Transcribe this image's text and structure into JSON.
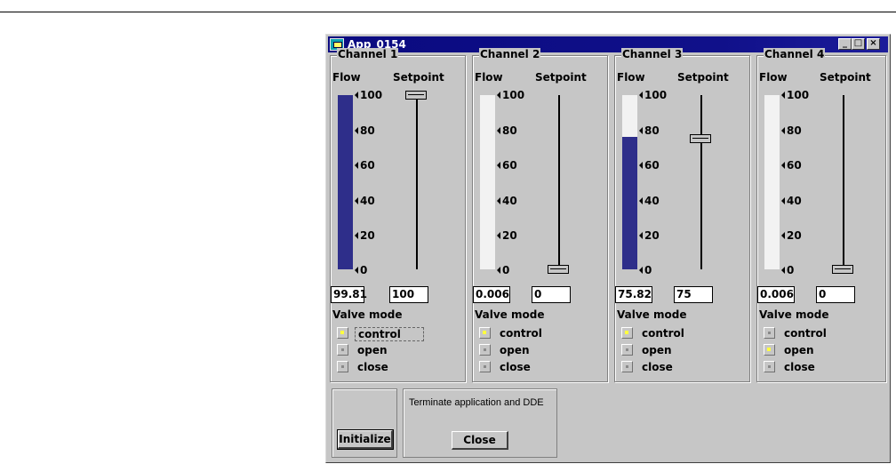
{
  "window": {
    "title": "App_0154",
    "minimize": "_",
    "maximize": "□",
    "close": "×"
  },
  "labels": {
    "flow": "Flow",
    "setpoint": "Setpoint",
    "valve_mode": "Valve mode"
  },
  "ticks": [
    "100",
    "80",
    "60",
    "40",
    "20",
    "0"
  ],
  "channels": [
    {
      "title": "Channel 1",
      "flow_value": "99.81",
      "setpoint_value": "100",
      "flow_level": 99.81,
      "setpoint_level": 100,
      "modes": [
        "control",
        "open",
        "close"
      ],
      "selected_mode": "control"
    },
    {
      "title": "Channel 2",
      "flow_value": "0.006",
      "setpoint_value": "0",
      "flow_level": 0.006,
      "setpoint_level": 0,
      "modes": [
        "control",
        "open",
        "close"
      ],
      "selected_mode": "control"
    },
    {
      "title": "Channel 3",
      "flow_value": "75.82",
      "setpoint_value": "75",
      "flow_level": 75.82,
      "setpoint_level": 75,
      "modes": [
        "control",
        "open",
        "close"
      ],
      "selected_mode": "control"
    },
    {
      "title": "Channel 4",
      "flow_value": "0.006",
      "setpoint_value": "0",
      "flow_level": 0.006,
      "setpoint_level": 0,
      "modes": [
        "control",
        "open",
        "close"
      ],
      "selected_mode": "open"
    }
  ],
  "initialize_label": "Initialize",
  "terminate_text": "Terminate application and DDE",
  "close_label": "Close",
  "colors": {
    "flow_fill": "#2e2e8a",
    "flow_track": "#f2f2f2",
    "title_bar": "#0a0a80",
    "radio_on": "#ffff40"
  }
}
